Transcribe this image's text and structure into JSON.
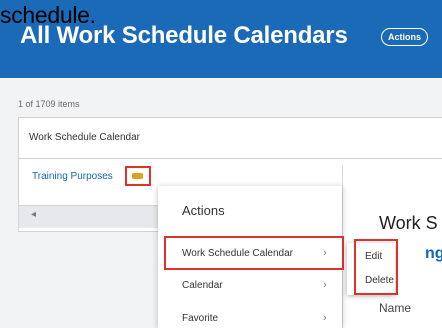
{
  "header": {
    "title": "All Work Schedule Calendars",
    "actions_button": "Actions",
    "overlay_text": "schedule."
  },
  "table": {
    "count_text": "1 of 1709 items",
    "column_header": "Work Schedule Calendar",
    "row_link": "Training Purposes",
    "scroll_left": "◂"
  },
  "actions_menu": {
    "heading": "Actions",
    "items": [
      {
        "label": "Work Schedule Calendar",
        "chevron": "›"
      },
      {
        "label": "Calendar",
        "chevron": "›"
      },
      {
        "label": "Favorite",
        "chevron": "›"
      }
    ]
  },
  "submenu": {
    "items": [
      {
        "label": "Edit"
      },
      {
        "label": "Delete"
      }
    ]
  },
  "right_panel": {
    "title": "Work S",
    "link_fragment": "ng",
    "name_label": "Name"
  },
  "colors": {
    "header_bg": "#1b6ab8",
    "highlight": "#d9342b",
    "link": "#1466b8"
  }
}
